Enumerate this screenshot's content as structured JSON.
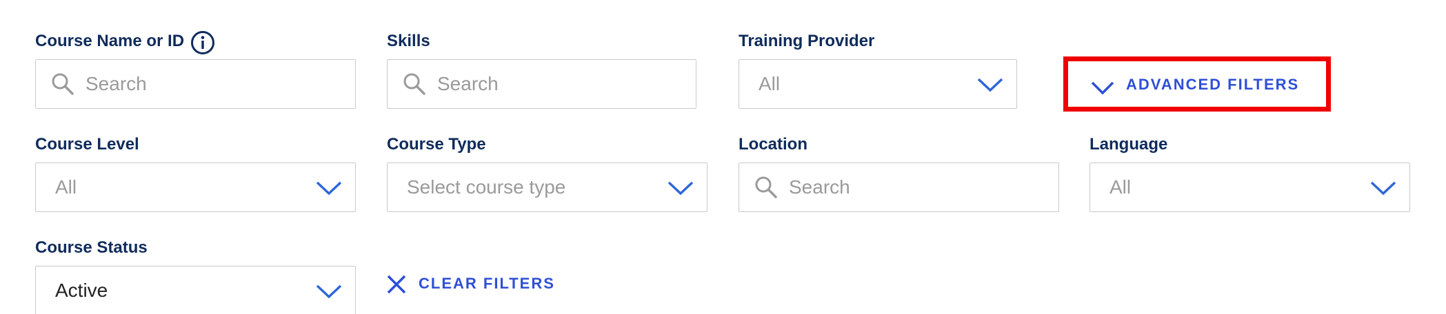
{
  "filters": {
    "course_name": {
      "label": "Course Name or ID",
      "placeholder": "Search",
      "icon": "search-icon",
      "info_icon": "info-icon"
    },
    "skills": {
      "label": "Skills",
      "placeholder": "Search",
      "icon": "search-icon"
    },
    "training_provider": {
      "label": "Training Provider",
      "value": "All"
    },
    "course_level": {
      "label": "Course Level",
      "value": "All"
    },
    "course_type": {
      "label": "Course Type",
      "value": "Select course type"
    },
    "location": {
      "label": "Location",
      "placeholder": "Search",
      "icon": "search-icon"
    },
    "language": {
      "label": "Language",
      "value": "All"
    },
    "course_status": {
      "label": "Course Status",
      "value": "Active"
    }
  },
  "actions": {
    "advanced_filters": {
      "label": "ADVANCED FILTERS",
      "icon": "chevron-down-icon",
      "highlight_color": "#f00000"
    },
    "clear_filters": {
      "label": "CLEAR FILTERS",
      "icon": "close-icon"
    }
  },
  "colors": {
    "label": "#0f2b5b",
    "link": "#2e4fd6",
    "chevron": "#2f67d8",
    "placeholder": "#9a9a9a",
    "border": "#c9c9c9"
  }
}
